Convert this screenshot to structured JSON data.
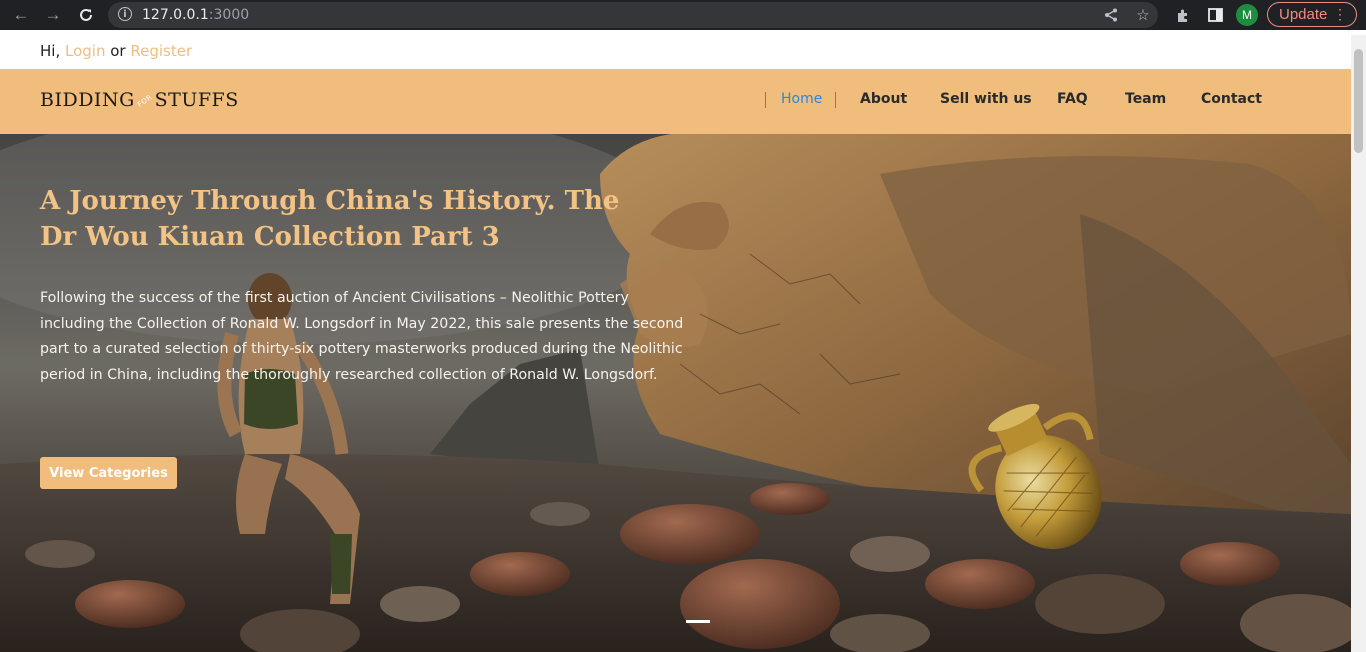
{
  "browser": {
    "back_icon": "arrow-left-icon",
    "forward_icon": "arrow-right-icon",
    "reload_icon": "reload-icon",
    "url_host": "127.0.0.1",
    "url_port": ":3000",
    "avatar_letter": "M",
    "update_label": "Update"
  },
  "topbar": {
    "greeting": "Hi,",
    "login": "Login",
    "or": "or",
    "register": "Register"
  },
  "header": {
    "logo_left": "BIDDING",
    "logo_for": "FOR",
    "logo_right": "STUFFS",
    "menu": [
      "Home",
      "About",
      "Sell with us",
      "FAQ",
      "Team",
      "Contact"
    ],
    "active": "Home"
  },
  "hero": {
    "title": "A Journey Through China's History. The Dr Wou Kiuan Collection Part 3",
    "text": "Following the success of the first auction of Ancient Civilisations – Neolithic Pottery including the Collection of Ronald W. Longsdorf in May 2022, this sale presents the second part to a curated selection of thirty-six pottery masterworks produced during the Neolithic period in China, including the thoroughly researched collection of Ronald W. Longsdorf.",
    "cta": "View Categories"
  },
  "colors": {
    "header_bg": "#f0bd7c",
    "accent_link": "#efbd84",
    "active_menu": "#2e86de",
    "hero_title": "#f3c385"
  }
}
